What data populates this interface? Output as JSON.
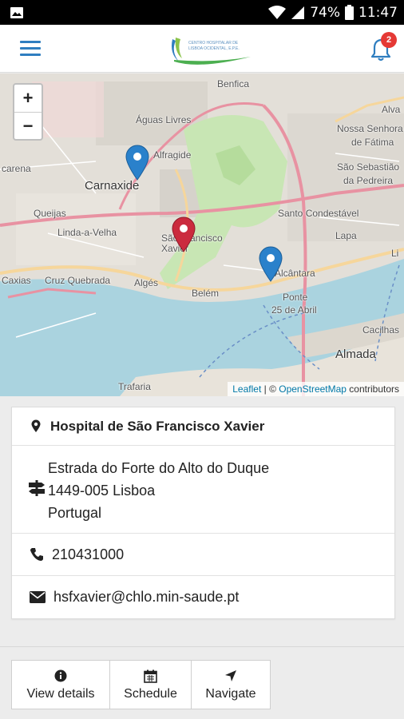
{
  "status_bar": {
    "battery_percent": "74%",
    "time": "11:47"
  },
  "header": {
    "notification_count": "2",
    "logo_line1": "CENTRO HOSPITALAR DE",
    "logo_line2": "LISBOA OCIDENTAL, E.P.E."
  },
  "map": {
    "zoom_in": "+",
    "zoom_out": "−",
    "labels": {
      "benfica": "Benfica",
      "aguas_livres": "Águas Livres",
      "alfragide": "Alfragide",
      "carnaxide": "Carnaxide",
      "queijas": "Queijas",
      "linda_a_velha": "Linda-a-Velha",
      "cruz_quebrada": "Cruz Quebrada",
      "alges": "Algés",
      "belem": "Belém",
      "sao_francisco_xavier": "São Francisco Xavier",
      "alcantara": "Alcântara",
      "ponte": "Ponte",
      "ponte2": "25 de Abril",
      "santo_condestavel": "Santo Condestável",
      "lapa": "Lapa",
      "sao_sebastiao": "São Sebastião",
      "sao_sebastiao2": "da Pedreira",
      "nossa_senhora": "Nossa Senhora",
      "nossa_senhora2": "de Fátima",
      "alvalade": "Alva",
      "almada": "Almada",
      "cacilhas": "Cacilhas",
      "trafaria": "Trafaria",
      "caxias": "Caxias",
      "barcarena": "carena",
      "li": "Li"
    },
    "attribution": {
      "leaflet": "Leaflet",
      "sep": " | © ",
      "osm": "OpenStreetMap",
      "suffix": " contributors"
    },
    "colors": {
      "water": "#aad3df",
      "park": "#c8e6b4",
      "urban": "#e0dcd5",
      "road_major": "#e892a2",
      "road_secondary": "#f6d69b",
      "pin_blue": "#2a81cb",
      "pin_red": "#cb2b3e"
    }
  },
  "location": {
    "name": "Hospital de São Francisco Xavier",
    "address_line1": "Estrada do Forte do Alto do Duque",
    "address_line2": "1449-005 Lisboa",
    "address_line3": "Portugal",
    "phone": "210431000",
    "email": "hsfxavier@chlo.min-saude.pt",
    "icons": {
      "name": "map-marker-icon",
      "address": "signpost-icon",
      "phone": "phone-icon",
      "email": "envelope-icon"
    }
  },
  "actions": {
    "view_details": "View details",
    "schedule": "Schedule",
    "navigate": "Navigate"
  }
}
